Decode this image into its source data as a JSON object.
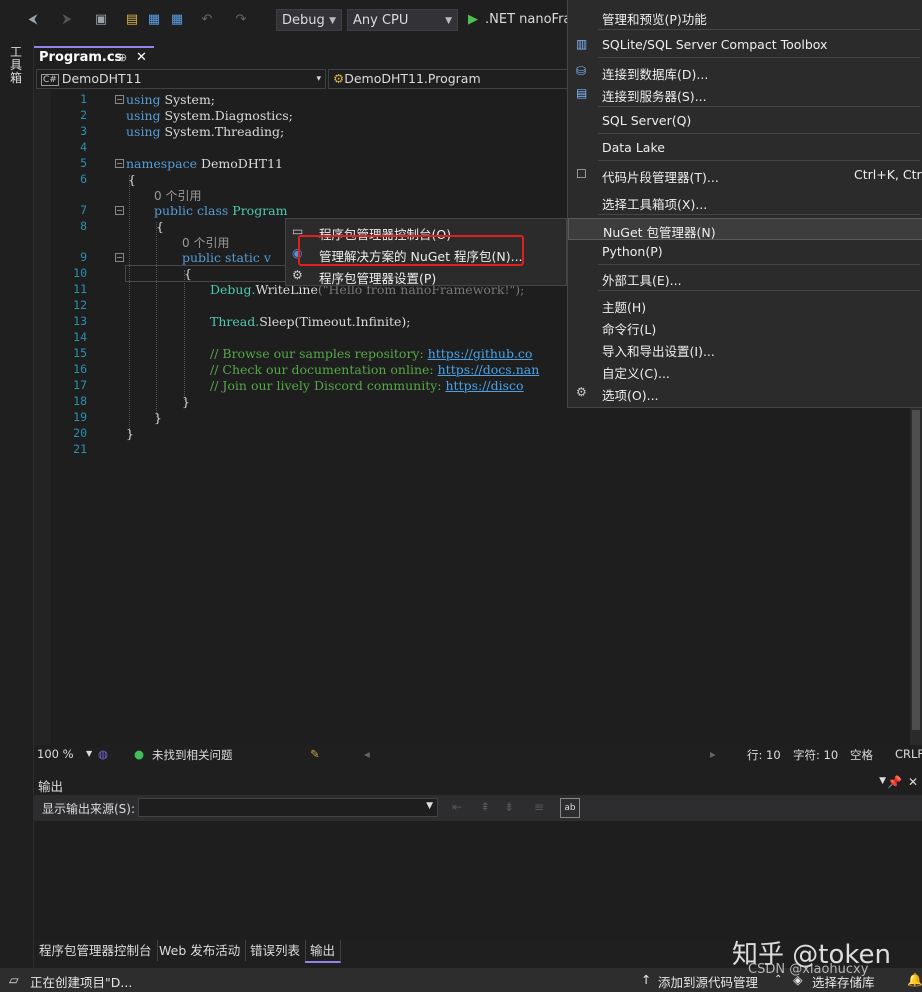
{
  "toolbar": {
    "config": "Debug",
    "platform": "Any CPU",
    "run_target": ".NET nanoFrar"
  },
  "siderail": {
    "toolbox_label": "工具箱"
  },
  "tab": {
    "name": "Program.cs",
    "pin": "⊕",
    "close": "✕"
  },
  "nav": {
    "project": "DemoDHT11",
    "class": "DemoDHT11.Program"
  },
  "editor": {
    "line_numbers": [
      "1",
      "2",
      "3",
      "4",
      "5",
      "6",
      "7",
      "8",
      "9",
      "10",
      "11",
      "12",
      "13",
      "14",
      "15",
      "16",
      "17",
      "18",
      "19",
      "20",
      "21"
    ],
    "refs": "0 个引用",
    "lines": {
      "l1a": "using",
      "l1b": " System;",
      "l2a": "using",
      "l2b": " System.Diagnostics;",
      "l3a": "using",
      "l3b": " System.Threading;",
      "l5a": "namespace",
      "l5b": " DemoDHT11",
      "l6": "{",
      "l7a": "public class",
      "l7b": " Program",
      "l8": "{",
      "l9a": "public static v",
      "l10": "{",
      "l11a": "Debug.",
      "l11b": "WriteLine",
      "l11c": "(\"Hello from nanoFramework!\");",
      "l13a": "Thread.",
      "l13b": "Sleep(Timeout.Infinite);",
      "l15a": "// Browse our samples repository: ",
      "l15b": "https://github.co",
      "l16a": "// Check our documentation online: ",
      "l16b": "https://docs.nan",
      "l17a": "// Join our lively Discord community: ",
      "l17b": "https://disco",
      "l18": "}",
      "l19": "}",
      "l20": "}"
    }
  },
  "editor_status": {
    "zoom": "100 %",
    "issues": "未找到相关问题",
    "line": "行: 10",
    "col": "字符: 10",
    "space": "空格",
    "eol": "CRLF"
  },
  "output": {
    "title": "输出",
    "source_label": "显示输出来源(S):",
    "source_value": ""
  },
  "bottom_tabs": [
    "程序包管理器控制台",
    "Web 发布活动",
    "错误列表",
    "输出"
  ],
  "statusbar": {
    "status": "正在创建项目\"D...",
    "add_source": "添加到源代码管理",
    "select_repo": "选择存储库"
  },
  "tools_menu": {
    "items": [
      {
        "label": "管理和预览(P)功能",
        "icon": "none"
      },
      {
        "label": "SQLite/SQL Server Compact Toolbox",
        "icon": "db-icon"
      },
      {
        "label": "连接到数据库(D)...",
        "icon": "connect-db-icon"
      },
      {
        "label": "连接到服务器(S)...",
        "icon": "server-icon"
      },
      {
        "label": "SQL Server(Q)",
        "icon": "none"
      },
      {
        "label": "Data Lake",
        "icon": "none"
      },
      {
        "label": "代码片段管理器(T)...",
        "icon": "snippet-icon",
        "shortcut": "Ctrl+K, Ctrl+"
      },
      {
        "label": "选择工具箱项(X)...",
        "icon": "none"
      },
      {
        "label": "NuGet 包管理器(N)",
        "icon": "none"
      },
      {
        "label": "Python(P)",
        "icon": "none"
      },
      {
        "label": "外部工具(E)...",
        "icon": "none"
      },
      {
        "label": "主题(H)",
        "icon": "none"
      },
      {
        "label": "命令行(L)",
        "icon": "none"
      },
      {
        "label": "导入和导出设置(I)...",
        "icon": "none"
      },
      {
        "label": "自定义(C)...",
        "icon": "none"
      },
      {
        "label": "选项(O)...",
        "icon": "gear-icon"
      }
    ]
  },
  "nuget_submenu": {
    "items": [
      {
        "label": "程序包管理器控制台(O)",
        "icon": "console-icon"
      },
      {
        "label": "管理解决方案的 NuGet 程序包(N)...",
        "icon": "nuget-icon"
      },
      {
        "label": "程序包管理器设置(P)",
        "icon": "gear-icon"
      }
    ]
  },
  "watermark": {
    "line1": "知乎 @token",
    "line2": "CSDN @xiaohucxy"
  }
}
